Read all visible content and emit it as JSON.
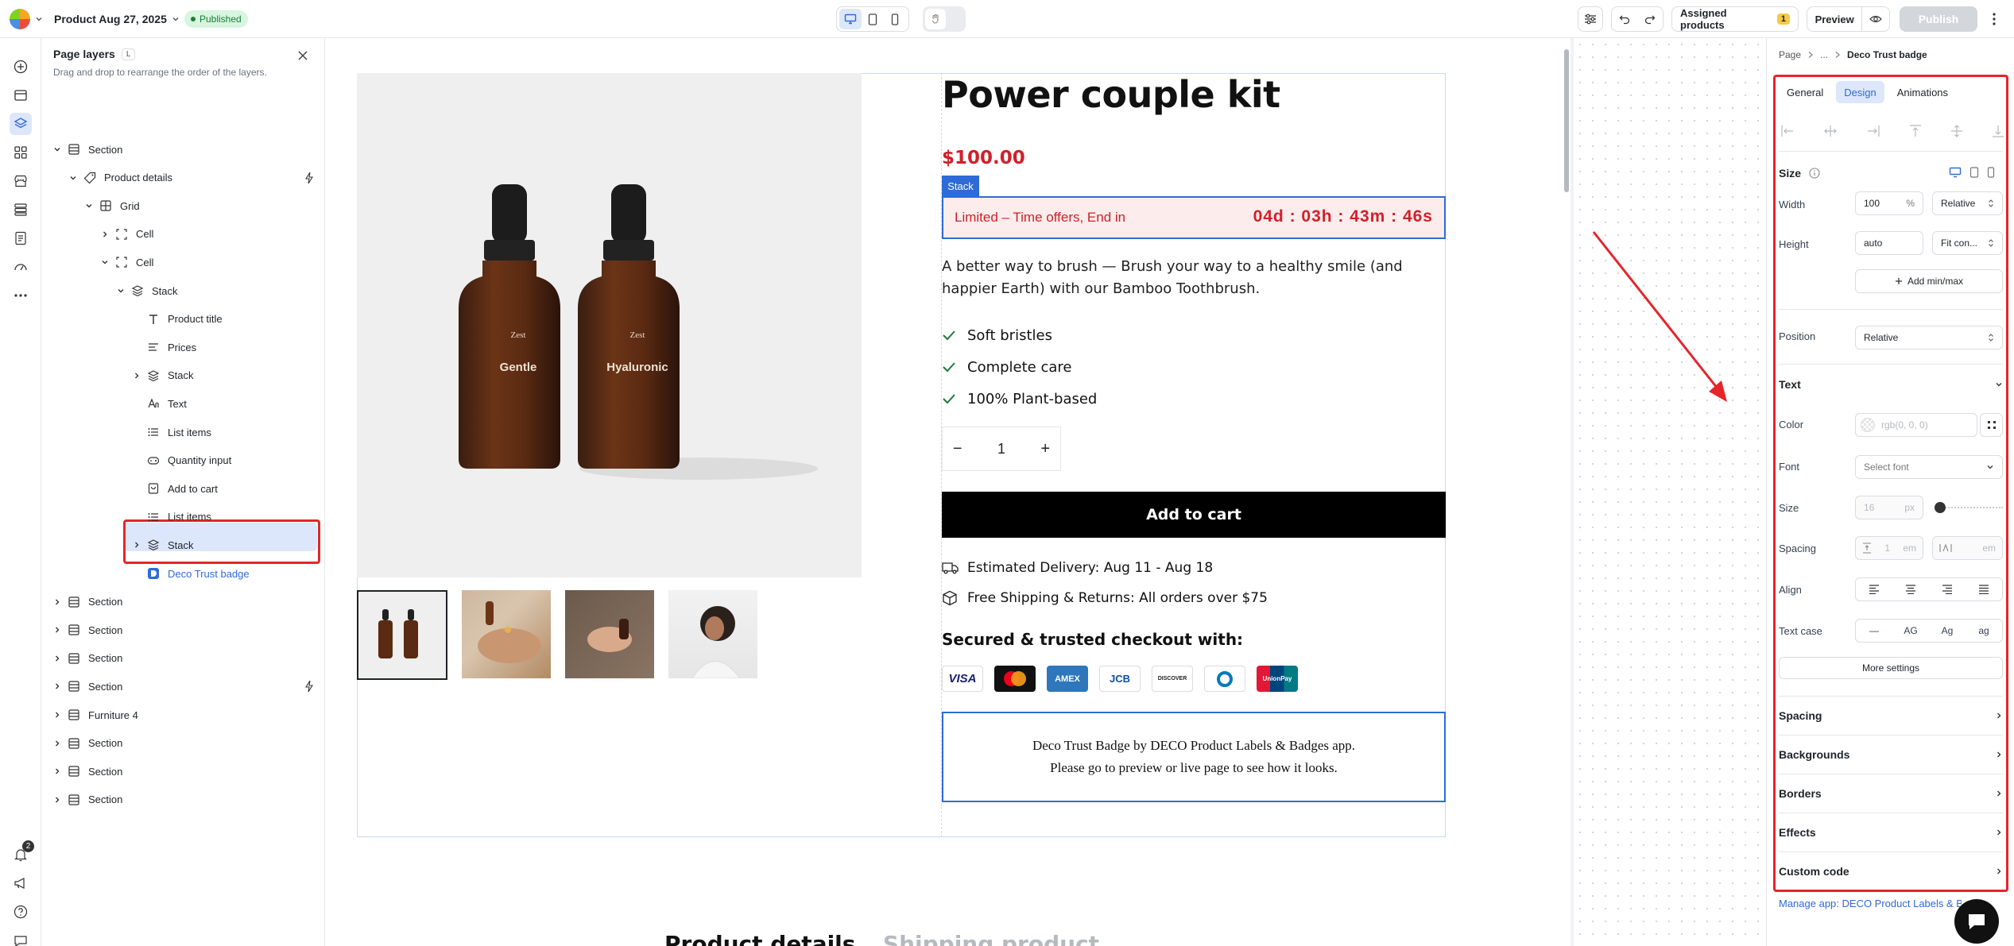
{
  "topbar": {
    "product_title": "Product Aug 27, 2025",
    "status": "Published",
    "assigned_label": "Assigned products",
    "assigned_count": "1",
    "preview_label": "Preview",
    "publish_label": "Publish"
  },
  "rail": {
    "notification_count": "2"
  },
  "layers": {
    "title": "Page layers",
    "shortcut": "L",
    "hint": "Drag and drop to rearrange the order of the layers.",
    "items": [
      {
        "label": "Section"
      },
      {
        "label": "Product details"
      },
      {
        "label": "Grid"
      },
      {
        "label": "Cell"
      },
      {
        "label": "Cell"
      },
      {
        "label": "Stack"
      },
      {
        "label": "Product title"
      },
      {
        "label": "Prices"
      },
      {
        "label": "Stack"
      },
      {
        "label": "Text"
      },
      {
        "label": "List items"
      },
      {
        "label": "Quantity input"
      },
      {
        "label": "Add to cart"
      },
      {
        "label": "List items"
      },
      {
        "label": "Stack"
      },
      {
        "label": "Deco Trust badge"
      },
      {
        "label": "Section"
      },
      {
        "label": "Section"
      },
      {
        "label": "Section"
      },
      {
        "label": "Section"
      },
      {
        "label": "Furniture 4"
      },
      {
        "label": "Section"
      },
      {
        "label": "Section"
      },
      {
        "label": "Section"
      }
    ]
  },
  "product": {
    "title": "Power couple kit",
    "price": "$100.00",
    "stack_tag": "Stack",
    "offer_text": "Limited – Time offers, End in",
    "countdown": "04d : 03h : 43m : 46s",
    "description": "A better way to brush — Brush your way to a healthy smile (and happier Earth) with our Bamboo Toothbrush.",
    "features": [
      "Soft bristles",
      "Complete care",
      "100% Plant-based"
    ],
    "quantity": "1",
    "qty_minus": "−",
    "qty_plus": "+",
    "add_to_cart": "Add to cart",
    "delivery": "Estimated Delivery: Aug 11 - Aug 18",
    "shipping": "Free Shipping & Returns: All orders over $75",
    "secure_title": "Secured & trusted checkout with:",
    "payments": [
      "VISA",
      "MC",
      "AMEX",
      "JCB",
      "DISCOVER",
      "DINERS",
      "UnionPay"
    ],
    "badge_line1": "Deco Trust Badge by DECO Product Labels & Badges app.",
    "badge_line2": "Please go to preview or live page to see how it looks.",
    "bottle1_brand": "Zest",
    "bottle1_name": "Gentle",
    "bottle2_brand": "Zest",
    "bottle2_name": "Hyaluronic",
    "bottom_heading_1": "Product details",
    "bottom_heading_2": "Shipping product"
  },
  "panel": {
    "breadcrumb": [
      "Page",
      "...",
      "Deco Trust badge"
    ],
    "tabs": [
      "General",
      "Design",
      "Animations"
    ],
    "active_tab": "Design",
    "size_label": "Size",
    "width_label": "Width",
    "width_value": "100",
    "width_unit": "%",
    "width_mode": "Relative",
    "height_label": "Height",
    "height_value": "auto",
    "height_mode": "Fit con...",
    "add_minmax": "Add min/max",
    "position_label": "Position",
    "position_value": "Relative",
    "text_section": "Text",
    "color_label": "Color",
    "color_placeholder": "rgb(0, 0, 0)",
    "font_label": "Font",
    "font_placeholder": "Select font",
    "fsize_label": "Size",
    "fsize_placeholder": "16",
    "fsize_unit": "px",
    "spacing_label": "Spacing",
    "spacing_value": "1",
    "spacing_unit": "em",
    "letter_unit": "em",
    "align_label": "Align",
    "textcase_label": "Text case",
    "textcase_options": [
      "—",
      "AG",
      "Ag",
      "ag"
    ],
    "more_settings": "More settings",
    "sections": [
      "Spacing",
      "Backgrounds",
      "Borders",
      "Effects",
      "Custom code"
    ],
    "manage_link": "Manage app: DECO Product Labels & Badges"
  },
  "colors": {
    "accent": "#2f6bd8",
    "price_red": "#d0202a",
    "highlight_red": "#e5252a",
    "published_bg": "#d8f5df",
    "published_fg": "#1a7f37"
  }
}
